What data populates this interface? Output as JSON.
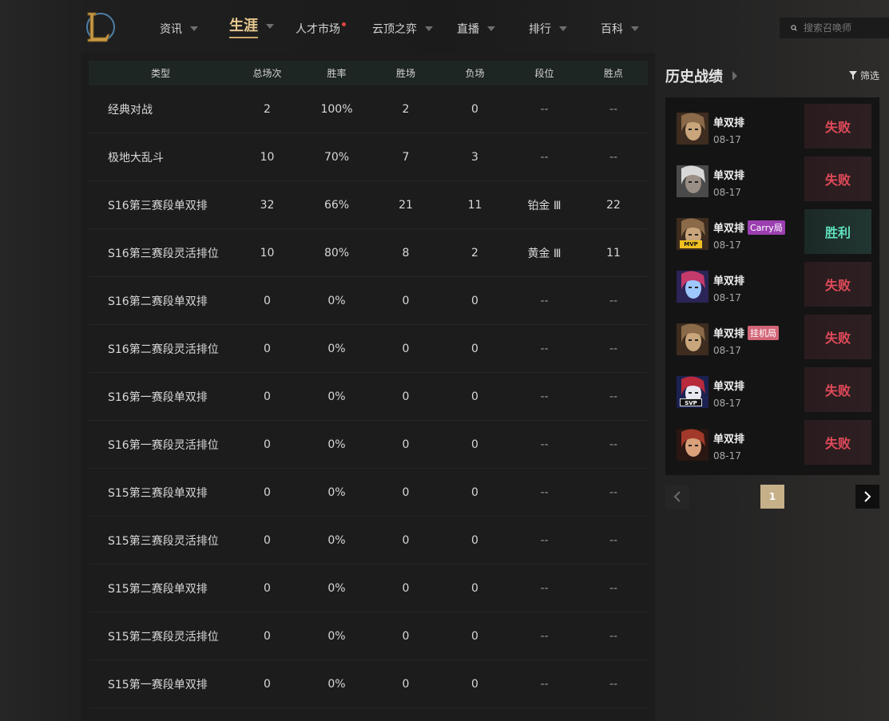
{
  "nav": {
    "items": [
      {
        "label": "资讯",
        "active": false
      },
      {
        "label": "生涯",
        "active": true
      },
      {
        "label": "人才市场",
        "active": false,
        "dot": true
      },
      {
        "label": "云顶之弈",
        "active": false
      },
      {
        "label": "直播",
        "active": false
      },
      {
        "label": "排行",
        "active": false
      },
      {
        "label": "百科",
        "active": false
      }
    ],
    "search_placeholder": "搜索召唤师"
  },
  "stats_table": {
    "headers": [
      "类型",
      "总场次",
      "胜率",
      "胜场",
      "负场",
      "段位",
      "胜点"
    ],
    "rows": [
      [
        "经典对战",
        "2",
        "100%",
        "2",
        "0",
        "--",
        "--"
      ],
      [
        "极地大乱斗",
        "10",
        "70%",
        "7",
        "3",
        "--",
        "--"
      ],
      [
        "S16第三赛段单双排",
        "32",
        "66%",
        "21",
        "11",
        "铂金 Ⅲ",
        "22"
      ],
      [
        "S16第三赛段灵活排位",
        "10",
        "80%",
        "8",
        "2",
        "黄金 Ⅲ",
        "11"
      ],
      [
        "S16第二赛段单双排",
        "0",
        "0%",
        "0",
        "0",
        "--",
        "--"
      ],
      [
        "S16第二赛段灵活排位",
        "0",
        "0%",
        "0",
        "0",
        "--",
        "--"
      ],
      [
        "S16第一赛段单双排",
        "0",
        "0%",
        "0",
        "0",
        "--",
        "--"
      ],
      [
        "S16第一赛段灵活排位",
        "0",
        "0%",
        "0",
        "0",
        "--",
        "--"
      ],
      [
        "S15第三赛段单双排",
        "0",
        "0%",
        "0",
        "0",
        "--",
        "--"
      ],
      [
        "S15第三赛段灵活排位",
        "0",
        "0%",
        "0",
        "0",
        "--",
        "--"
      ],
      [
        "S15第二赛段单双排",
        "0",
        "0%",
        "0",
        "0",
        "--",
        "--"
      ],
      [
        "S15第二赛段灵活排位",
        "0",
        "0%",
        "0",
        "0",
        "--",
        "--"
      ],
      [
        "S15第一赛段单双排",
        "0",
        "0%",
        "0",
        "0",
        "--",
        "--"
      ]
    ]
  },
  "history": {
    "title": "历史战绩",
    "filter_label": "筛选",
    "matches": [
      {
        "mode": "单双排",
        "date": "08-17",
        "result": "失败",
        "win": false,
        "tag": "",
        "tag_type": "",
        "badge": "",
        "champion_icon": "champion-portrait-1",
        "palette": [
          "#3d2c1f",
          "#8a6a48",
          "#c9a57c"
        ]
      },
      {
        "mode": "单双排",
        "date": "08-17",
        "result": "失败",
        "win": false,
        "tag": "",
        "tag_type": "",
        "badge": "",
        "champion_icon": "champion-portrait-2",
        "palette": [
          "#4a4a4a",
          "#d8d8d8",
          "#9a8f86"
        ]
      },
      {
        "mode": "单双排",
        "date": "08-17",
        "result": "胜利",
        "win": true,
        "tag": "Carry局",
        "tag_type": "carry",
        "badge": "MVP",
        "champion_icon": "champion-portrait-1",
        "palette": [
          "#3d2c1f",
          "#8a6a48",
          "#c9a57c"
        ]
      },
      {
        "mode": "单双排",
        "date": "08-17",
        "result": "失败",
        "win": false,
        "tag": "",
        "tag_type": "",
        "badge": "",
        "champion_icon": "champion-portrait-3",
        "palette": [
          "#2b2457",
          "#c43a6a",
          "#9ec7ff"
        ]
      },
      {
        "mode": "单双排",
        "date": "08-17",
        "result": "失败",
        "win": false,
        "tag": "挂机局",
        "tag_type": "afk",
        "badge": "",
        "champion_icon": "champion-portrait-1",
        "palette": [
          "#3d2c1f",
          "#8a6a48",
          "#c9a57c"
        ]
      },
      {
        "mode": "单双排",
        "date": "08-17",
        "result": "失败",
        "win": false,
        "tag": "",
        "tag_type": "",
        "badge": "SVP",
        "champion_icon": "champion-portrait-4",
        "palette": [
          "#1b2150",
          "#b82a3c",
          "#e8e8f2"
        ]
      },
      {
        "mode": "单双排",
        "date": "08-17",
        "result": "失败",
        "win": false,
        "tag": "",
        "tag_type": "",
        "badge": "",
        "champion_icon": "champion-portrait-5",
        "palette": [
          "#2a1612",
          "#a2392a",
          "#d9a07a"
        ]
      }
    ]
  },
  "pager": {
    "current": "1"
  }
}
